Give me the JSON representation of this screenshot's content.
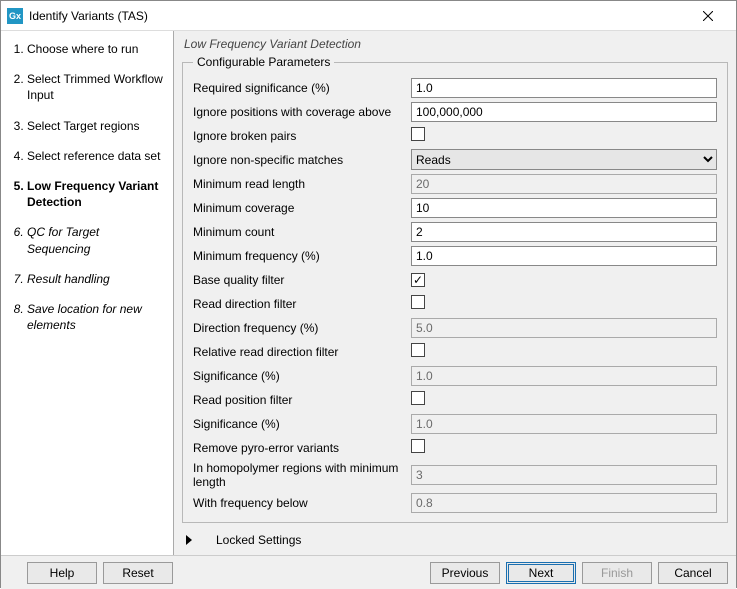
{
  "window": {
    "app_icon_text": "Gx",
    "title": "Identify Variants (TAS)"
  },
  "sidebar": {
    "items": [
      {
        "label": "Choose where to run",
        "active": false,
        "italic": false
      },
      {
        "label": "Select Trimmed Workflow Input",
        "active": false,
        "italic": false
      },
      {
        "label": "Select Target regions",
        "active": false,
        "italic": false
      },
      {
        "label": "Select reference data set",
        "active": false,
        "italic": false
      },
      {
        "label": "Low Frequency Variant Detection",
        "active": true,
        "italic": false
      },
      {
        "label": "QC for Target Sequencing",
        "active": false,
        "italic": true
      },
      {
        "label": "Result handling",
        "active": false,
        "italic": true
      },
      {
        "label": "Save location for new elements",
        "active": false,
        "italic": true
      }
    ]
  },
  "main": {
    "header": "Low Frequency Variant Detection",
    "fieldset_legend": "Configurable Parameters",
    "locked_settings_label": "Locked Settings",
    "params": [
      {
        "label": "Required significance (%)",
        "type": "text",
        "value": "1.0",
        "disabled": false
      },
      {
        "label": "Ignore positions with coverage above",
        "type": "text",
        "value": "100,000,000",
        "disabled": false
      },
      {
        "label": "Ignore broken pairs",
        "type": "checkbox",
        "checked": false
      },
      {
        "label": "Ignore non-specific matches",
        "type": "select",
        "value": "Reads"
      },
      {
        "label": "Minimum read length",
        "type": "text",
        "value": "20",
        "disabled": true
      },
      {
        "label": "Minimum coverage",
        "type": "text",
        "value": "10",
        "disabled": false
      },
      {
        "label": "Minimum count",
        "type": "text",
        "value": "2",
        "disabled": false
      },
      {
        "label": "Minimum frequency (%)",
        "type": "text",
        "value": "1.0",
        "disabled": false
      },
      {
        "label": "Base quality filter",
        "type": "checkbox",
        "checked": true
      },
      {
        "label": "Read direction filter",
        "type": "checkbox",
        "checked": false
      },
      {
        "label": "Direction frequency (%)",
        "type": "text",
        "value": "5.0",
        "disabled": true
      },
      {
        "label": "Relative read direction filter",
        "type": "checkbox",
        "checked": false
      },
      {
        "label": "Significance (%)",
        "type": "text",
        "value": "1.0",
        "disabled": true
      },
      {
        "label": "Read position filter",
        "type": "checkbox",
        "checked": false
      },
      {
        "label": "Significance (%)",
        "type": "text",
        "value": "1.0",
        "disabled": true
      },
      {
        "label": "Remove pyro-error variants",
        "type": "checkbox",
        "checked": false
      },
      {
        "label": "In homopolymer regions with minimum length",
        "type": "text",
        "value": "3",
        "disabled": true
      },
      {
        "label": "With frequency below",
        "type": "text",
        "value": "0.8",
        "disabled": true
      }
    ]
  },
  "footer": {
    "help": "Help",
    "reset": "Reset",
    "previous": "Previous",
    "next": "Next",
    "finish": "Finish",
    "cancel": "Cancel"
  }
}
